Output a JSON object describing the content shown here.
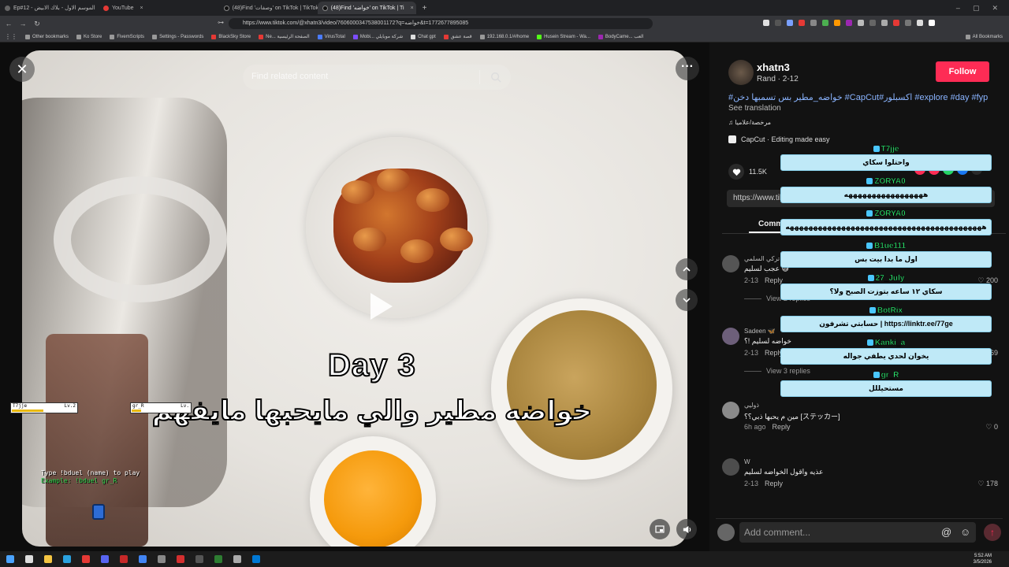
{
  "browser": {
    "tabs": [
      {
        "label": "Ep#12 - الموسم الاول - بلاك الابيض"
      },
      {
        "label": "YouTube"
      },
      {
        "label": "(48)Find 'وصفات' on TikTok | TikTok"
      },
      {
        "label": "(48)Find 'خواضه' on TikTok | Ti"
      }
    ],
    "url": "https://www.tiktok.com/@xhatn3/video/7606000347538001172?q=خواضه&t=1772677895085",
    "bookmarks": [
      "Other bookmarks",
      "Ko Store",
      "FivemScripts",
      "Settings - Passwords",
      "BlackSky Store",
      "Ne... الصفحة الرئيسية",
      "VirusTotal",
      "Mobi... شركة موبايلي",
      "Chat gpt",
      "قصة عشق",
      "192.168.0.1/#/home",
      "Husein Stream - Wa...",
      "BodyCame... العب"
    ],
    "all_bookmarks": "All Bookmarks"
  },
  "video": {
    "search_placeholder": "Find related content",
    "day_text": "Day 3",
    "caption": "خواضه مطير والي مايحبها مايفهم"
  },
  "overlay_game": {
    "p1_name": "T7jje",
    "p1_lv": "Lv.2",
    "p2_name": "gr_R",
    "p2_lv": "Lv.",
    "hint": "Type !bduel (name) to play",
    "example": "Example: !bduel gr_R"
  },
  "author": {
    "name": "xhatn3",
    "sub": "Rand · 2-12",
    "follow": "Follow",
    "description": "#خواضه_مطير بس تسمبها دخن #CapCut#اكسبلور #explore #day #fyp",
    "see_translation": "See translation",
    "music": "♫ مرخصة/علاميا",
    "capcut": "CapCut · Editing made easy",
    "likes": "11.5K",
    "link": "https://www.tiktok.com/@xhatn3/video/7606000347538001172"
  },
  "comments_tab": "Comments (150)",
  "comments": [
    {
      "user": "تركي السلمي",
      "text": "عجب لسليم 😅",
      "date": "2-13",
      "reply": "Reply",
      "likes": "200",
      "view": "View 2 replies"
    },
    {
      "user": "Sadeen 🦋",
      "text": "خواضه لسليم !؟",
      "date": "2-13",
      "reply": "Reply",
      "likes": "169",
      "view": "View 3 replies"
    },
    {
      "user": "ذوليي",
      "text": "مين م يحبها ذبي؟؟ [ステッカー]",
      "date": "6h ago",
      "reply": "Reply",
      "likes": "0",
      "view": ""
    },
    {
      "user": "W",
      "text": "عذيه واقول الخواضه لسليم",
      "date": "2-13",
      "reply": "Reply",
      "likes": "178",
      "view": ""
    }
  ],
  "add_comment_placeholder": "Add comment...",
  "chat": [
    {
      "name": "T7jje",
      "message": "واحتلوا سكاي"
    },
    {
      "name": "ZORYA0",
      "message": "هههههههههههههههههه"
    },
    {
      "name": "ZORYA0",
      "message": "ههههههههههههههههههههههههههههههههههههههههههه"
    },
    {
      "name": "B1ue111",
      "message": "اول ما بدا بيت بس"
    },
    {
      "name": "27_July",
      "message": "سكاي ١٢ ساعه بتوزت الصبح ولا؟"
    },
    {
      "name": "BotRix",
      "message": "حسابتي تشرفون | https://linktr.ee/77ge"
    },
    {
      "name": "Kanki_a",
      "message": "يخوان لحدي يطفي جواله"
    },
    {
      "name": "gr_R",
      "message": "مستحيللل"
    }
  ],
  "taskbar": {
    "time": "5:52 AM",
    "date": "3/5/2026"
  },
  "colors": {
    "follow": "#fe2c55",
    "chat_bubble": "#bfe9f7",
    "chat_name": "#2ee36e",
    "hashtag": "#8ab4ff"
  }
}
